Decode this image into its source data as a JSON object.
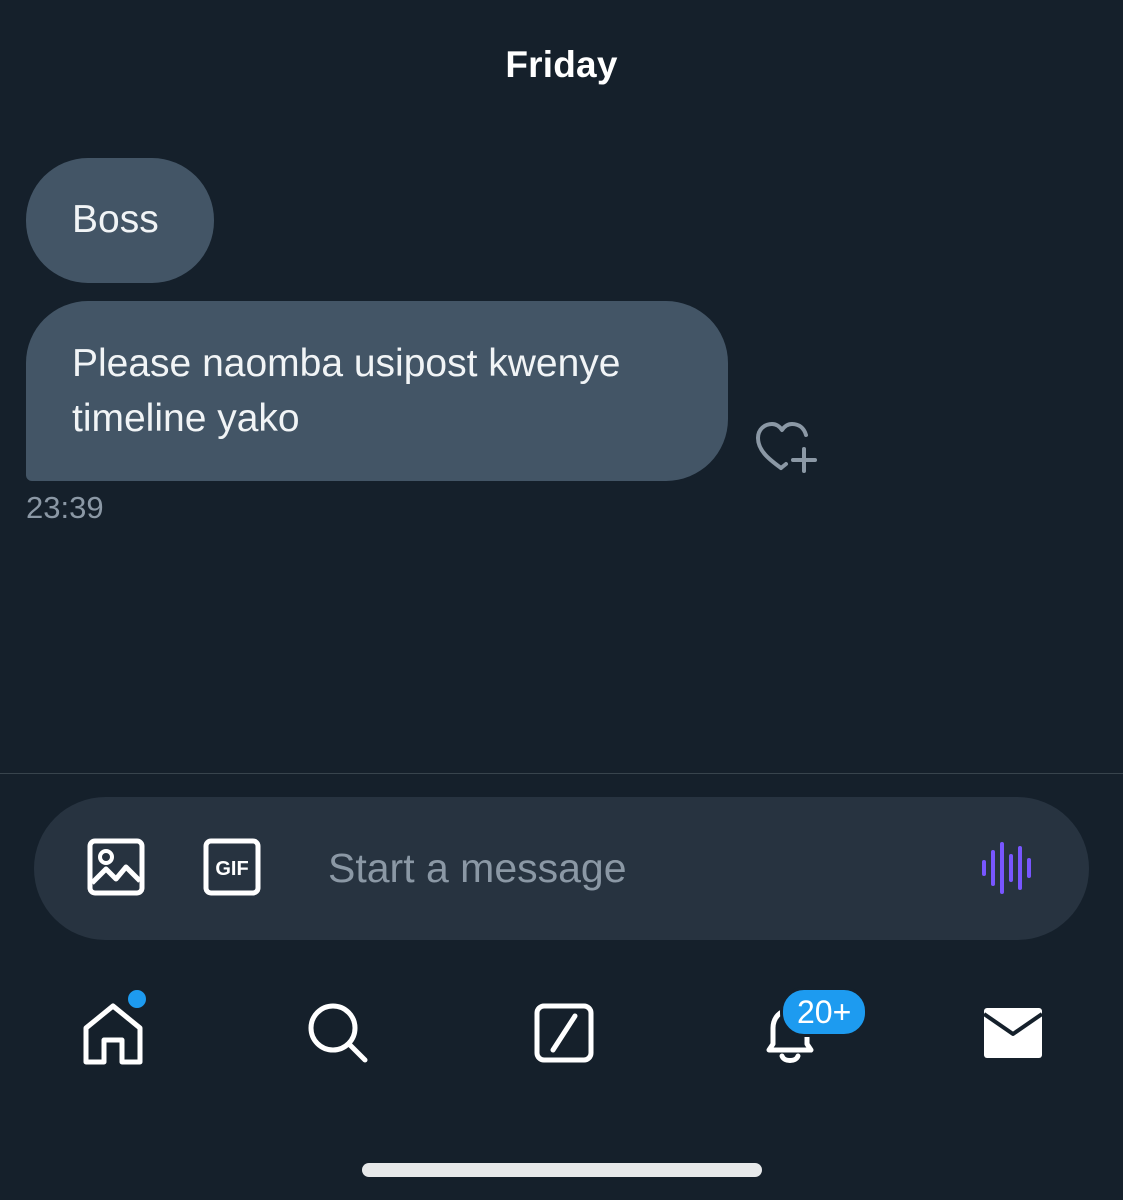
{
  "conversation": {
    "day_label": "Friday",
    "messages": [
      {
        "text": "Boss"
      },
      {
        "text": "Please naomba usipost kwenye timeline yako"
      }
    ],
    "timestamp": "23:39"
  },
  "composer": {
    "placeholder": "Start a message",
    "gif_label": "GIF",
    "icons": [
      "image-icon",
      "gif-icon",
      "voice-wave-icon"
    ]
  },
  "tabbar": {
    "items": [
      "home-icon",
      "search-icon",
      "compose-icon",
      "bell-icon",
      "mail-icon"
    ],
    "notifications_badge": "20+"
  },
  "colors": {
    "background": "#15202b",
    "bubble": "#435566",
    "composer": "#273340",
    "accent": "#1d9bf0",
    "voice": "#7856ff"
  }
}
